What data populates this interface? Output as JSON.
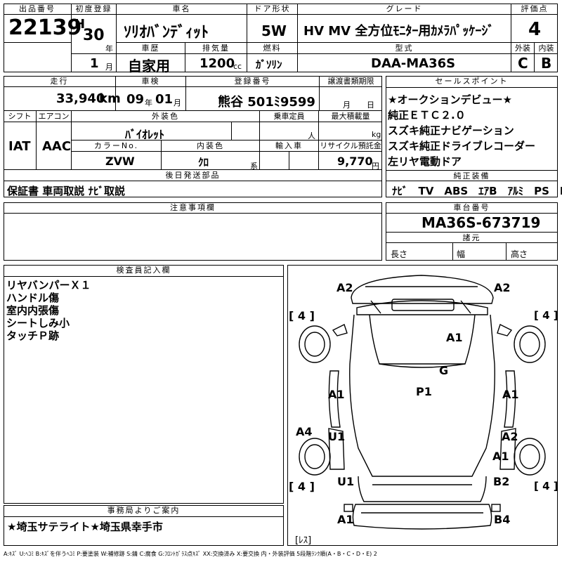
{
  "header": {
    "lot_no_label": "出品番号",
    "lot_no": "22139",
    "first_reg_label": "初度登録",
    "era": "H",
    "year": "30",
    "year_unit": "年",
    "month": "1",
    "month_unit": "月",
    "car_name_label": "車名",
    "car_name": "ｿﾘｵﾊﾞﾝﾃﾞｨｯﾄ",
    "history_label": "車歴",
    "history": "自家用",
    "displacement_label": "排気量",
    "displacement": "1200",
    "displacement_unit": "cc",
    "door_label": "ドア形状",
    "door": "5W",
    "fuel_label": "燃料",
    "fuel": "ｶﾞｿﾘﾝ",
    "grade_label": "グレード",
    "grade": "HV MV 全方位ﾓﾆﾀｰ用ｶﾒﾗﾊﾟｯｹｰｼﾞ",
    "model_label": "型式",
    "model": "DAA-MA36S",
    "score_label": "評価点",
    "score": "4",
    "ext_label": "外装",
    "ext": "C",
    "int_label": "内装",
    "int": "B"
  },
  "row2": {
    "mileage_label": "走行",
    "mileage": "33,940",
    "mileage_unit": "km",
    "inspection_label": "車検",
    "insp_year": "09",
    "insp_year_unit": "年",
    "insp_month": "01",
    "insp_month_unit": "月",
    "plate_label": "登録番号",
    "plate": "熊谷 501ﾐ9599",
    "transfer_label": "譲渡書類期限",
    "transfer_month_unit": "月",
    "transfer_day_unit": "日",
    "shift_label": "シフト",
    "shift": "IAT",
    "ac_label": "エアコン",
    "ac": "AAC",
    "color_label": "外装色",
    "color": "ﾊﾞｲｵﾚｯﾄ",
    "capacity_label": "乗車定員",
    "capacity_unit": "人",
    "load_label": "最大積載量",
    "load_unit": "kg",
    "color_no_label": "カラーNo.",
    "color_no": "ZVW",
    "int_color_label": "内装色",
    "int_color": "ｸﾛ",
    "int_color_suffix": "系",
    "import_label": "輸入車",
    "recycle_label": "リサイクル預託金",
    "recycle": "9,770",
    "recycle_unit": "円",
    "later_label": "後日発送部品",
    "later": "保証書 車両取説 ﾅﾋﾞ取説"
  },
  "sales": {
    "label": "セールスポイント",
    "items": [
      "★オークションデビュー★",
      "純正ＥＴＣ２.０",
      "スズキ純正ナビゲーション",
      "スズキ純正ドライブレコーダー",
      "左リヤ電動ドア"
    ],
    "equip_label": "純正装備",
    "equip": "ﾅﾋﾞ　TV　ABS　ｴｱB　ｱﾙﾐ　PS　PW"
  },
  "notes": {
    "label": "注意事項欄"
  },
  "chassis": {
    "label": "車台番号",
    "value": "MA36S-673719",
    "dims_label": "諸元",
    "length": "長さ",
    "width": "幅",
    "height": "高さ"
  },
  "inspector": {
    "label": "検査員記入欄",
    "lines": [
      "リヤバンパーＸ１",
      "ハンドル傷",
      "室内内張傷",
      "シートしみ小",
      "タッチＰ跡"
    ]
  },
  "office": {
    "label": "事務局よりご案内",
    "value": "★埼玉サテライト★埼玉県幸手市"
  },
  "diagram": {
    "marks": {
      "a2_left": "A2",
      "a2_right": "A2",
      "four_tl": "[ 4 ]",
      "four_tr": "[ 4 ]",
      "a1_hood": "A1",
      "g": "G",
      "p1": "P1",
      "a1_left": "A1",
      "a1_right": "A1",
      "a4": "A4",
      "u1_mid": "U1",
      "a2_mid": "A2",
      "a1_rr": "A1",
      "u1_low": "U1",
      "b2": "B2",
      "four_bl": "[ 4 ]",
      "four_br": "[ 4 ]",
      "a1_bottom": "A1",
      "b4": "B4",
      "resu": "[ﾚｽ]"
    }
  },
  "legend": "A:ｷｽﾞ U:ﾍｺﾐ B:ｷｽﾞを伴うﾍｺﾐ P:要塗装 W:補修跡 S:錆 C:腐食 G:ﾌﾛﾝﾄｶﾞﾗｽ点ｷｽﾞ XX:交換済み X:要交換 内・外装評価 5段階ﾗﾝｸ順(A・B・C・D・E) 2"
}
